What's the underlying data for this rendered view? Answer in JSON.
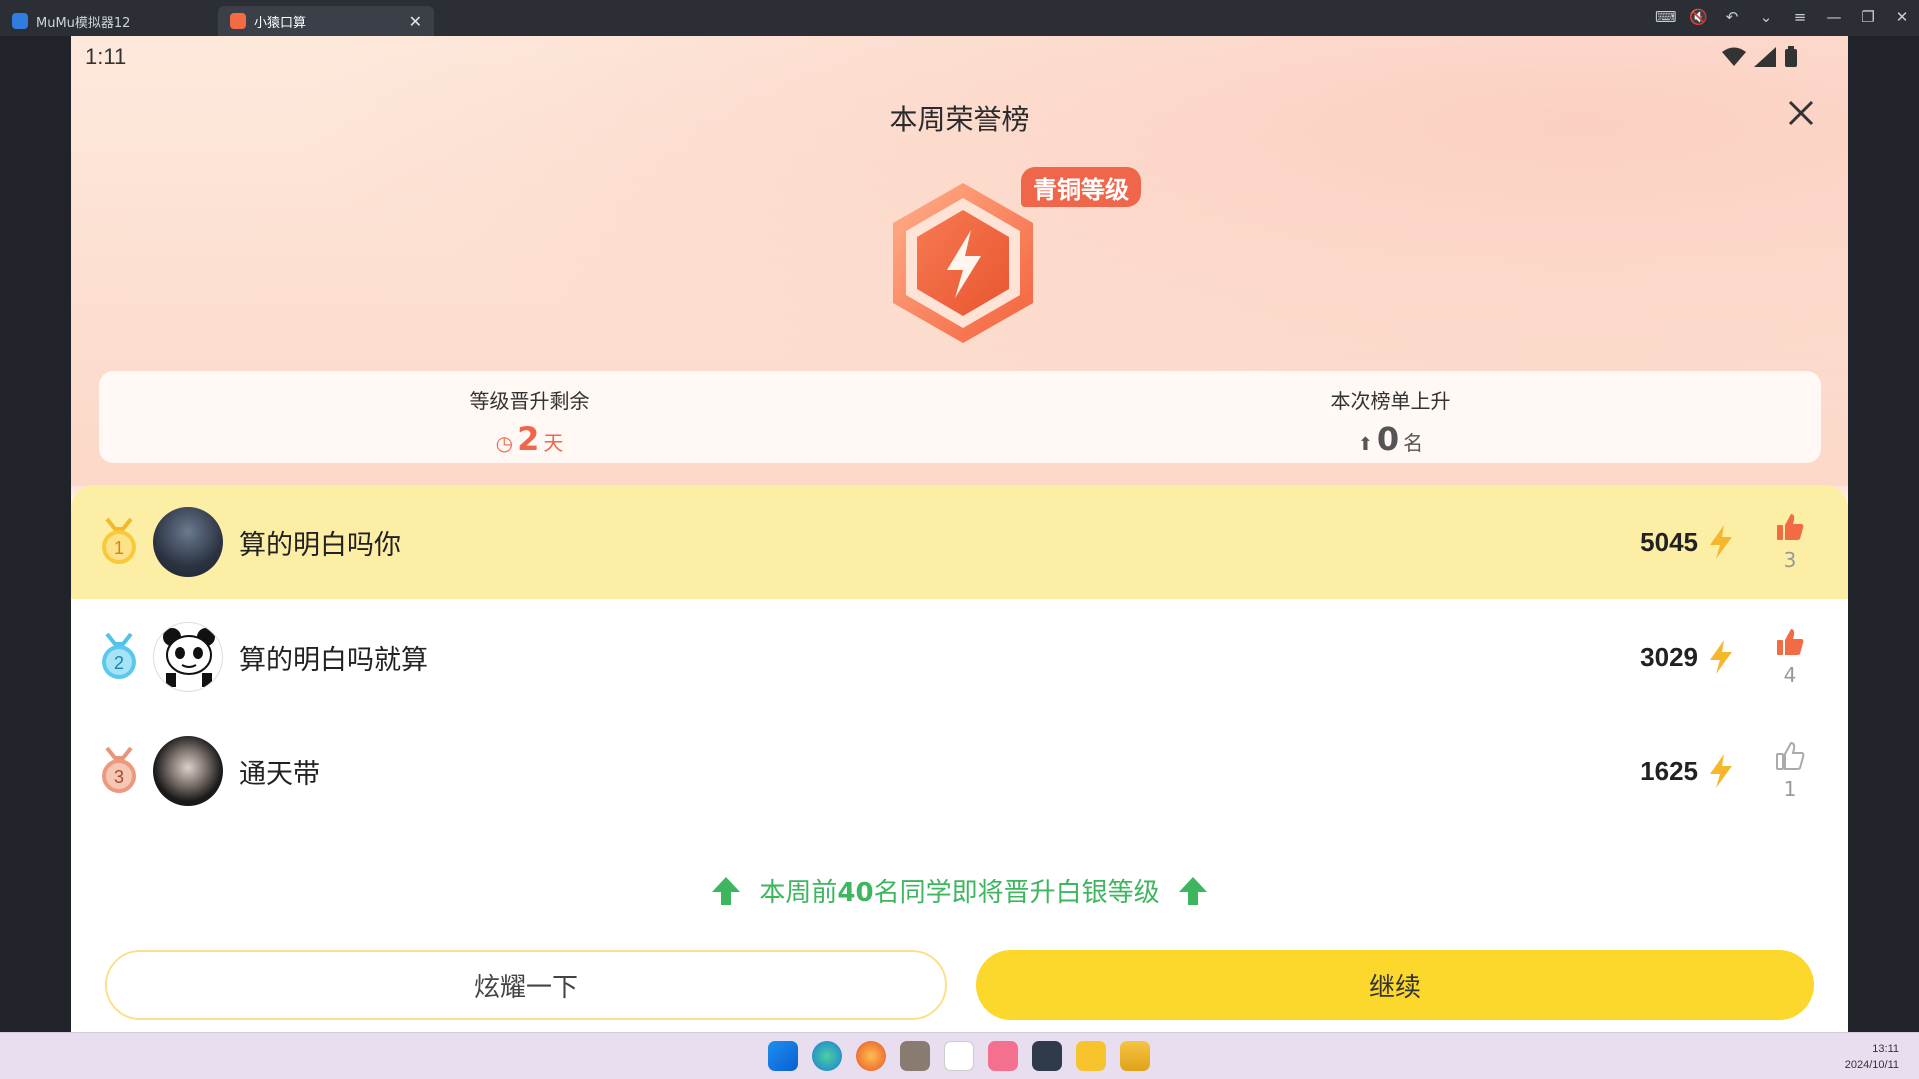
{
  "window": {
    "tabs": [
      {
        "label": "MuMu模拟器12",
        "icon": "mumu-icon"
      },
      {
        "label": "小猿口算",
        "icon": "app-icon",
        "active": true
      }
    ]
  },
  "status_bar": {
    "time": "1:11"
  },
  "header": {
    "title": "本周荣誉榜"
  },
  "badge": {
    "level_label": "青铜等级"
  },
  "info": {
    "left": {
      "label": "等级晋升剩余",
      "value": "2",
      "unit": "天"
    },
    "right": {
      "label": "本次榜单上升",
      "value": "0",
      "unit": "名"
    }
  },
  "ranking": [
    {
      "rank": "1",
      "name": "算的明白吗你",
      "score": "5045",
      "likes": "3",
      "liked": true
    },
    {
      "rank": "2",
      "name": "算的明白吗就算",
      "score": "3029",
      "likes": "4",
      "liked": true
    },
    {
      "rank": "3",
      "name": "通天带",
      "score": "1625",
      "likes": "1",
      "liked": false
    }
  ],
  "promo": {
    "prefix": "本周前",
    "count": "40",
    "suffix": "名同学即将晋升白银等级"
  },
  "buttons": {
    "show_off": "炫耀一下",
    "continue": "继续"
  },
  "taskbar": {
    "time": "13:11",
    "date": "2024/10/11"
  },
  "colors": {
    "accent_orange": "#f0664a",
    "gold_row": "#fdeea6",
    "continue_yellow": "#fcd72c",
    "promo_green": "#3db65f"
  }
}
